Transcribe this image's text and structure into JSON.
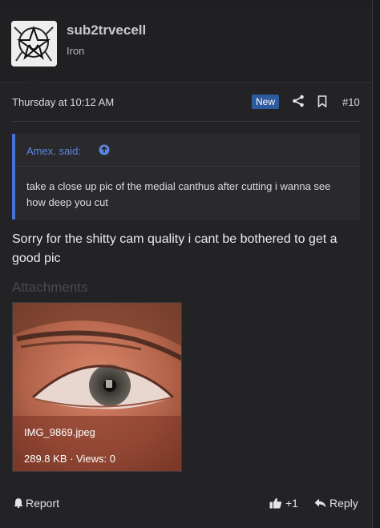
{
  "author": {
    "username": "sub2trvecell",
    "user_title": "Iron"
  },
  "meta": {
    "date": "Thursday at 10:12 AM",
    "new_badge": "New",
    "post_number": "#10",
    "icons": [
      "share-icon",
      "bookmark-icon"
    ]
  },
  "quote": {
    "attribution": "Amex. said:",
    "text": "take a close up pic of the medial canthus after cutting i wanna see how deep you cut",
    "accent_color": "#4a6fd4"
  },
  "post": {
    "body": "Sorry for the shitty cam quality i cant be bothered to get a good pic"
  },
  "attachments": {
    "title": "Attachments",
    "items": [
      {
        "filename": "IMG_9869.jpeg",
        "meta": "289.8 KB · Views: 0"
      }
    ]
  },
  "actions": {
    "report_label": "Report",
    "like_count": "+1",
    "reply_label": "Reply"
  },
  "colors": {
    "background": "#232325",
    "badge": "#2e5a9e",
    "link": "#5b86e5"
  }
}
